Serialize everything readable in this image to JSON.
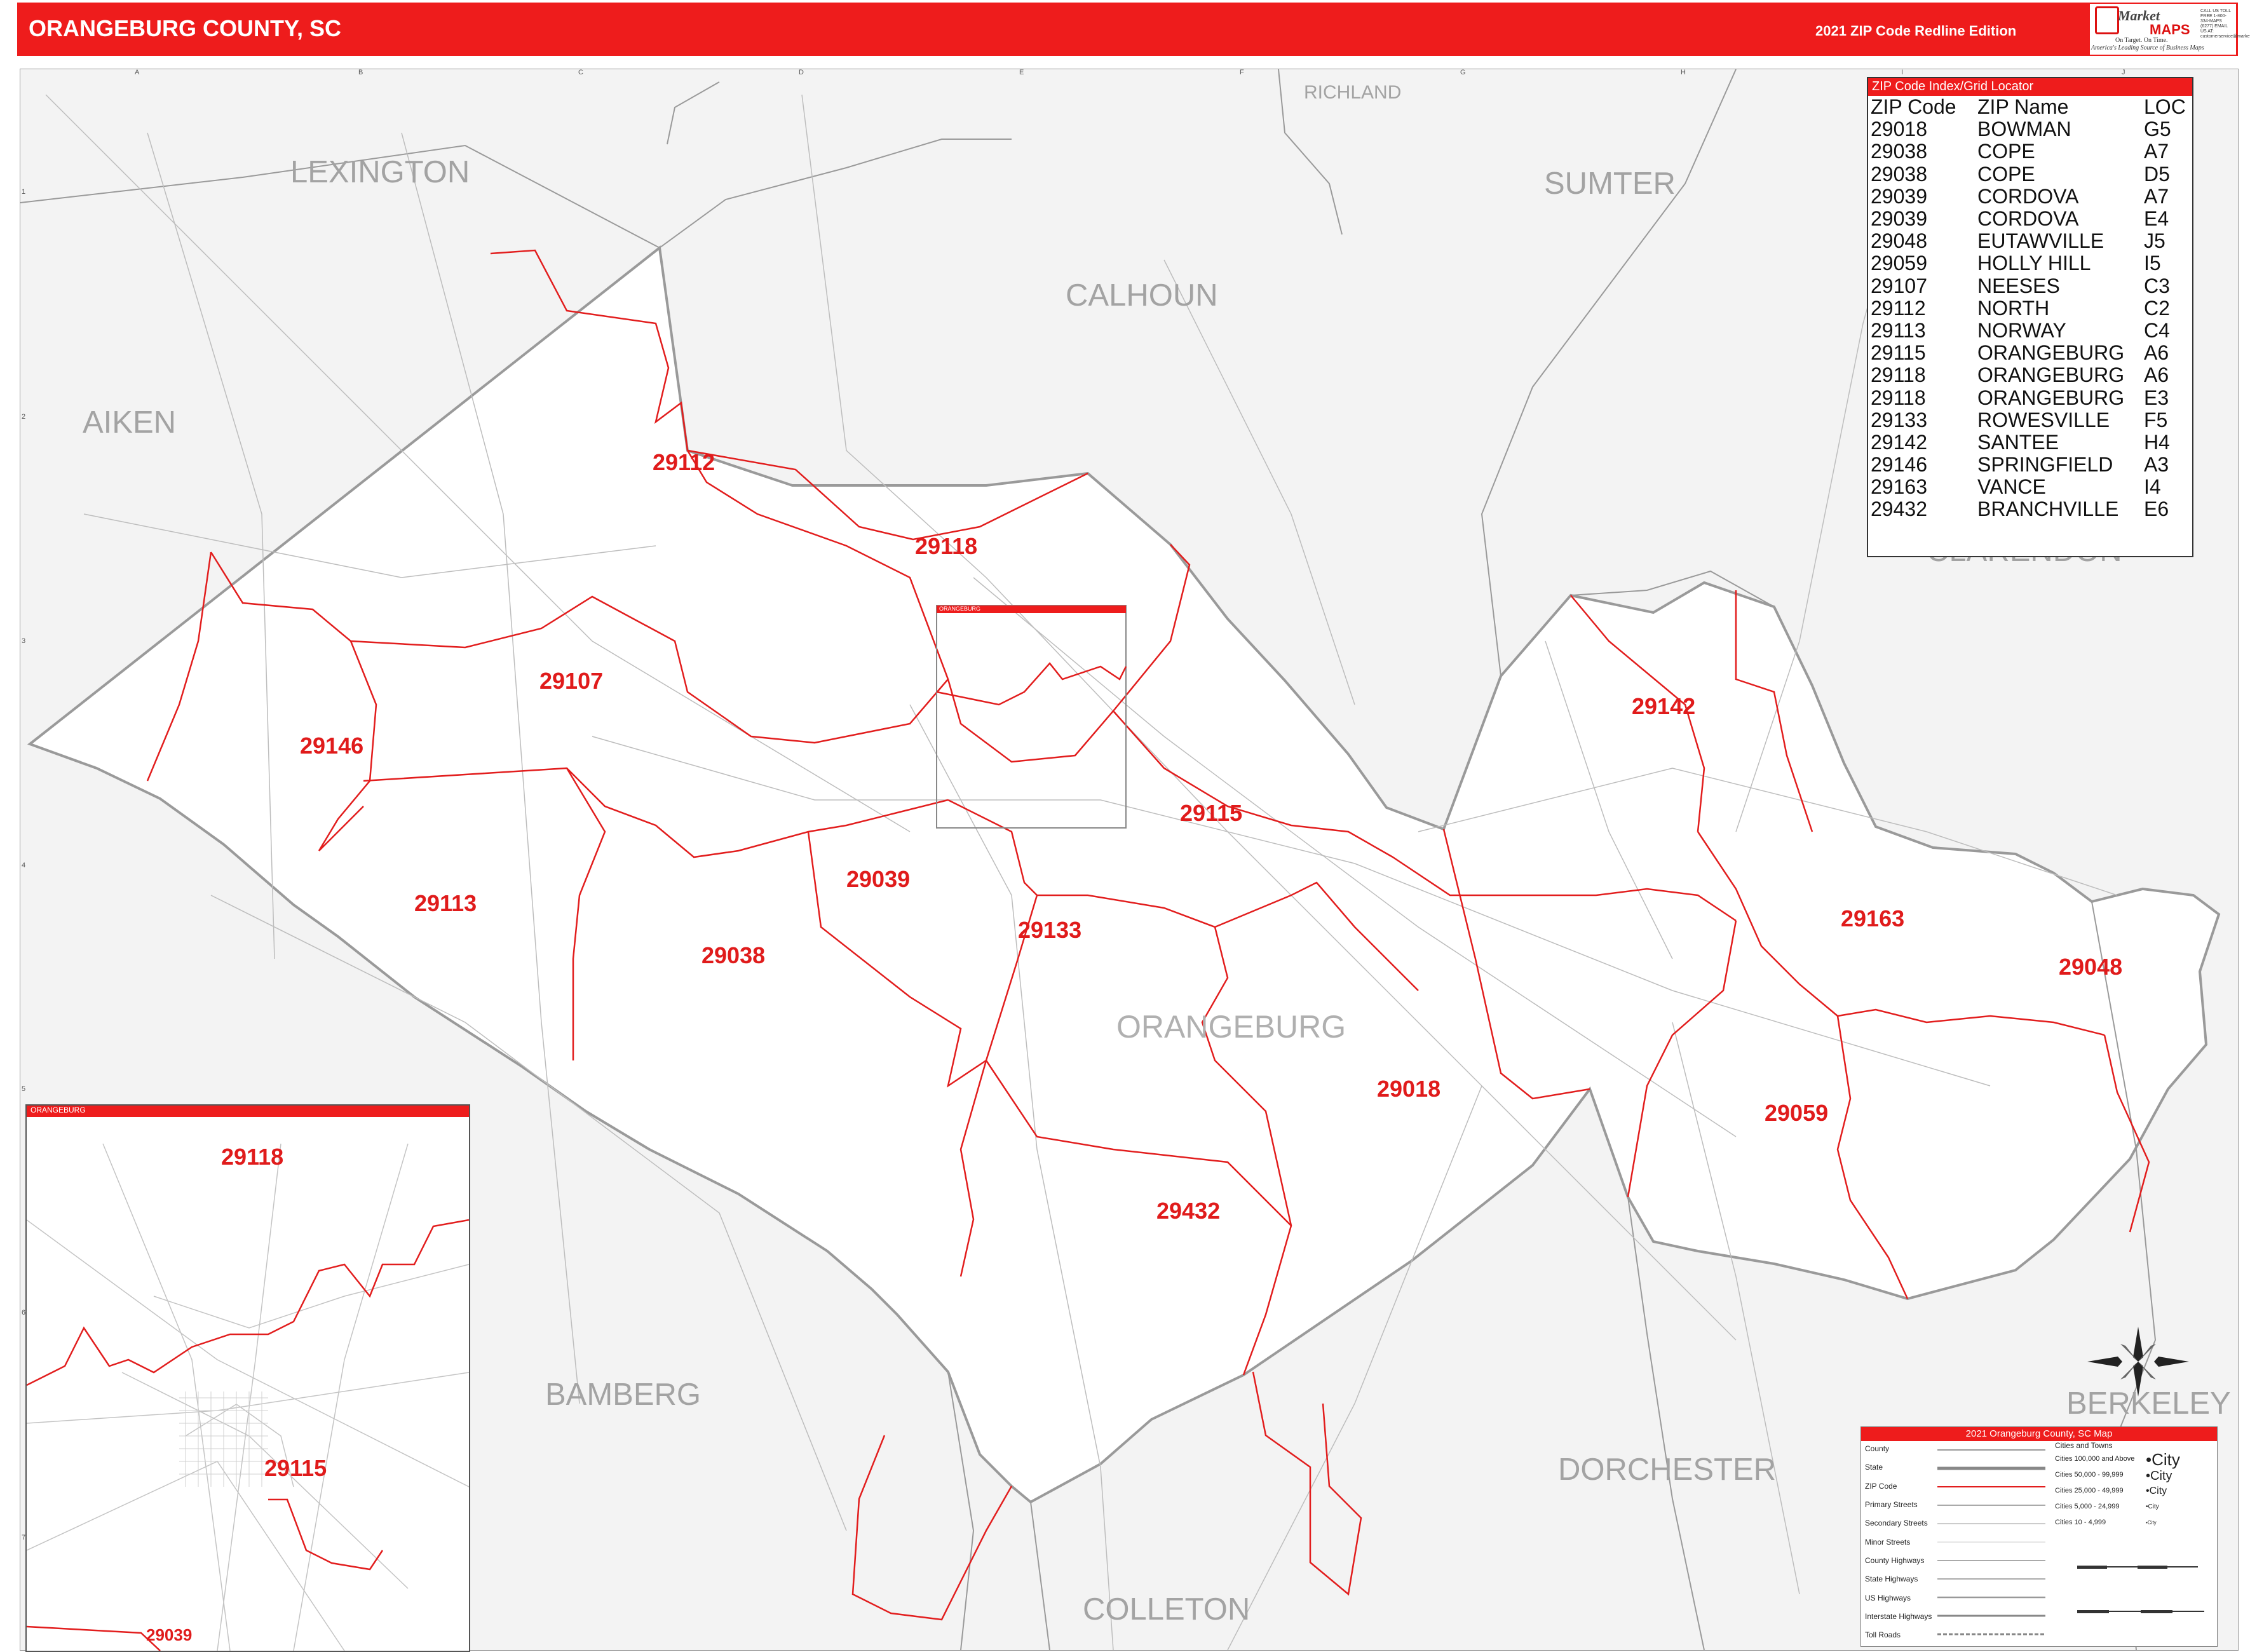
{
  "header": {
    "title": "ORANGEBURG COUNTY, SC",
    "edition": "2021 ZIP Code Redline Edition",
    "logo": {
      "name_top": "Market",
      "name_bottom": "MAPS",
      "tagline": "On Target. On Time.",
      "tagline2": "America's Leading Source of Business Maps",
      "contact": "CALL US TOLL FREE 1-800-334-MAPS (6277) EMAIL US AT: customerservice@marketmaps.com"
    }
  },
  "counties": {
    "richland": "RICHLAND",
    "lexington": "LEXINGTON",
    "sumter": "SUMTER",
    "calhoun": "CALHOUN",
    "aiken": "AIKEN",
    "clarendon": "CLARENDON",
    "orangeburg": "ORANGEBURG",
    "bamberg": "BAMBERG",
    "dorchester": "DORCHESTER",
    "berkeley": "BERKELEY",
    "colleton": "COLLETON"
  },
  "zip_labels": {
    "z29112": "29112",
    "z29118": "29118",
    "z29107": "29107",
    "z29146": "29146",
    "z29142": "29142",
    "z29115": "29115",
    "z29113": "29113",
    "z29039": "29039",
    "z29133": "29133",
    "z29038": "29038",
    "z29163": "29163",
    "z29048": "29048",
    "z29018": "29018",
    "z29059": "29059",
    "z29432": "29432"
  },
  "zip_index": {
    "title": "ZIP Code Index/Grid Locator",
    "headers": [
      "ZIP Code",
      "ZIP Name",
      "LOC"
    ],
    "rows": [
      [
        "29018",
        "BOWMAN",
        "G5"
      ],
      [
        "29038",
        "COPE",
        "A7"
      ],
      [
        "29038",
        "COPE",
        "D5"
      ],
      [
        "29039",
        "CORDOVA",
        "A7"
      ],
      [
        "29039",
        "CORDOVA",
        "E4"
      ],
      [
        "29048",
        "EUTAWVILLE",
        "J5"
      ],
      [
        "29059",
        "HOLLY HILL",
        "I5"
      ],
      [
        "29107",
        "NEESES",
        "C3"
      ],
      [
        "29112",
        "NORTH",
        "C2"
      ],
      [
        "29113",
        "NORWAY",
        "C4"
      ],
      [
        "29115",
        "ORANGEBURG",
        "A6"
      ],
      [
        "29118",
        "ORANGEBURG",
        "A6"
      ],
      [
        "29118",
        "ORANGEBURG",
        "E3"
      ],
      [
        "29133",
        "ROWESVILLE",
        "F5"
      ],
      [
        "29142",
        "SANTEE",
        "H4"
      ],
      [
        "29146",
        "SPRINGFIELD",
        "A3"
      ],
      [
        "29163",
        "VANCE",
        "I4"
      ],
      [
        "29432",
        "BRANCHVILLE",
        "E6"
      ]
    ]
  },
  "inset": {
    "title": "ORANGEBURG",
    "box_title": "ORANGEBURG",
    "zips": {
      "a": "29118",
      "b": "29115",
      "c": "29039"
    }
  },
  "legend": {
    "title": "2021 Orangeburg County, SC Map",
    "lines": [
      "County",
      "State",
      "ZIP Code",
      "Primary Streets",
      "Secondary Streets",
      "Minor Streets",
      "County Highways",
      "State Highways",
      "US Highways",
      "Interstate Highways",
      "Toll Roads"
    ],
    "cities_title": "Cities and Towns",
    "cities": [
      "Cities 100,000 and Above",
      "Cities 50,000 - 99,999",
      "Cities 25,000 - 49,999",
      "Cities 5,000 - 24,999",
      "Cities 10 - 4,999"
    ],
    "city_samples": [
      "•City",
      "•City",
      "•City",
      "•City",
      "•City"
    ]
  },
  "colors": {
    "brand_red": "#ee1c1c",
    "zip_line": "#e21d1d",
    "county_line": "#9a9a9a",
    "land_outside": "#f3f3f3",
    "land_inside": "#ffffff",
    "zip_text": "#e01b1b",
    "county_text": "#a3a3a3"
  },
  "icons": {
    "compass": "compass-rose-icon"
  },
  "grid": {
    "letters": [
      "A",
      "B",
      "C",
      "D",
      "E",
      "F",
      "G",
      "H",
      "I",
      "J"
    ],
    "numbers": [
      "1",
      "2",
      "3",
      "4",
      "5",
      "6",
      "7"
    ]
  }
}
